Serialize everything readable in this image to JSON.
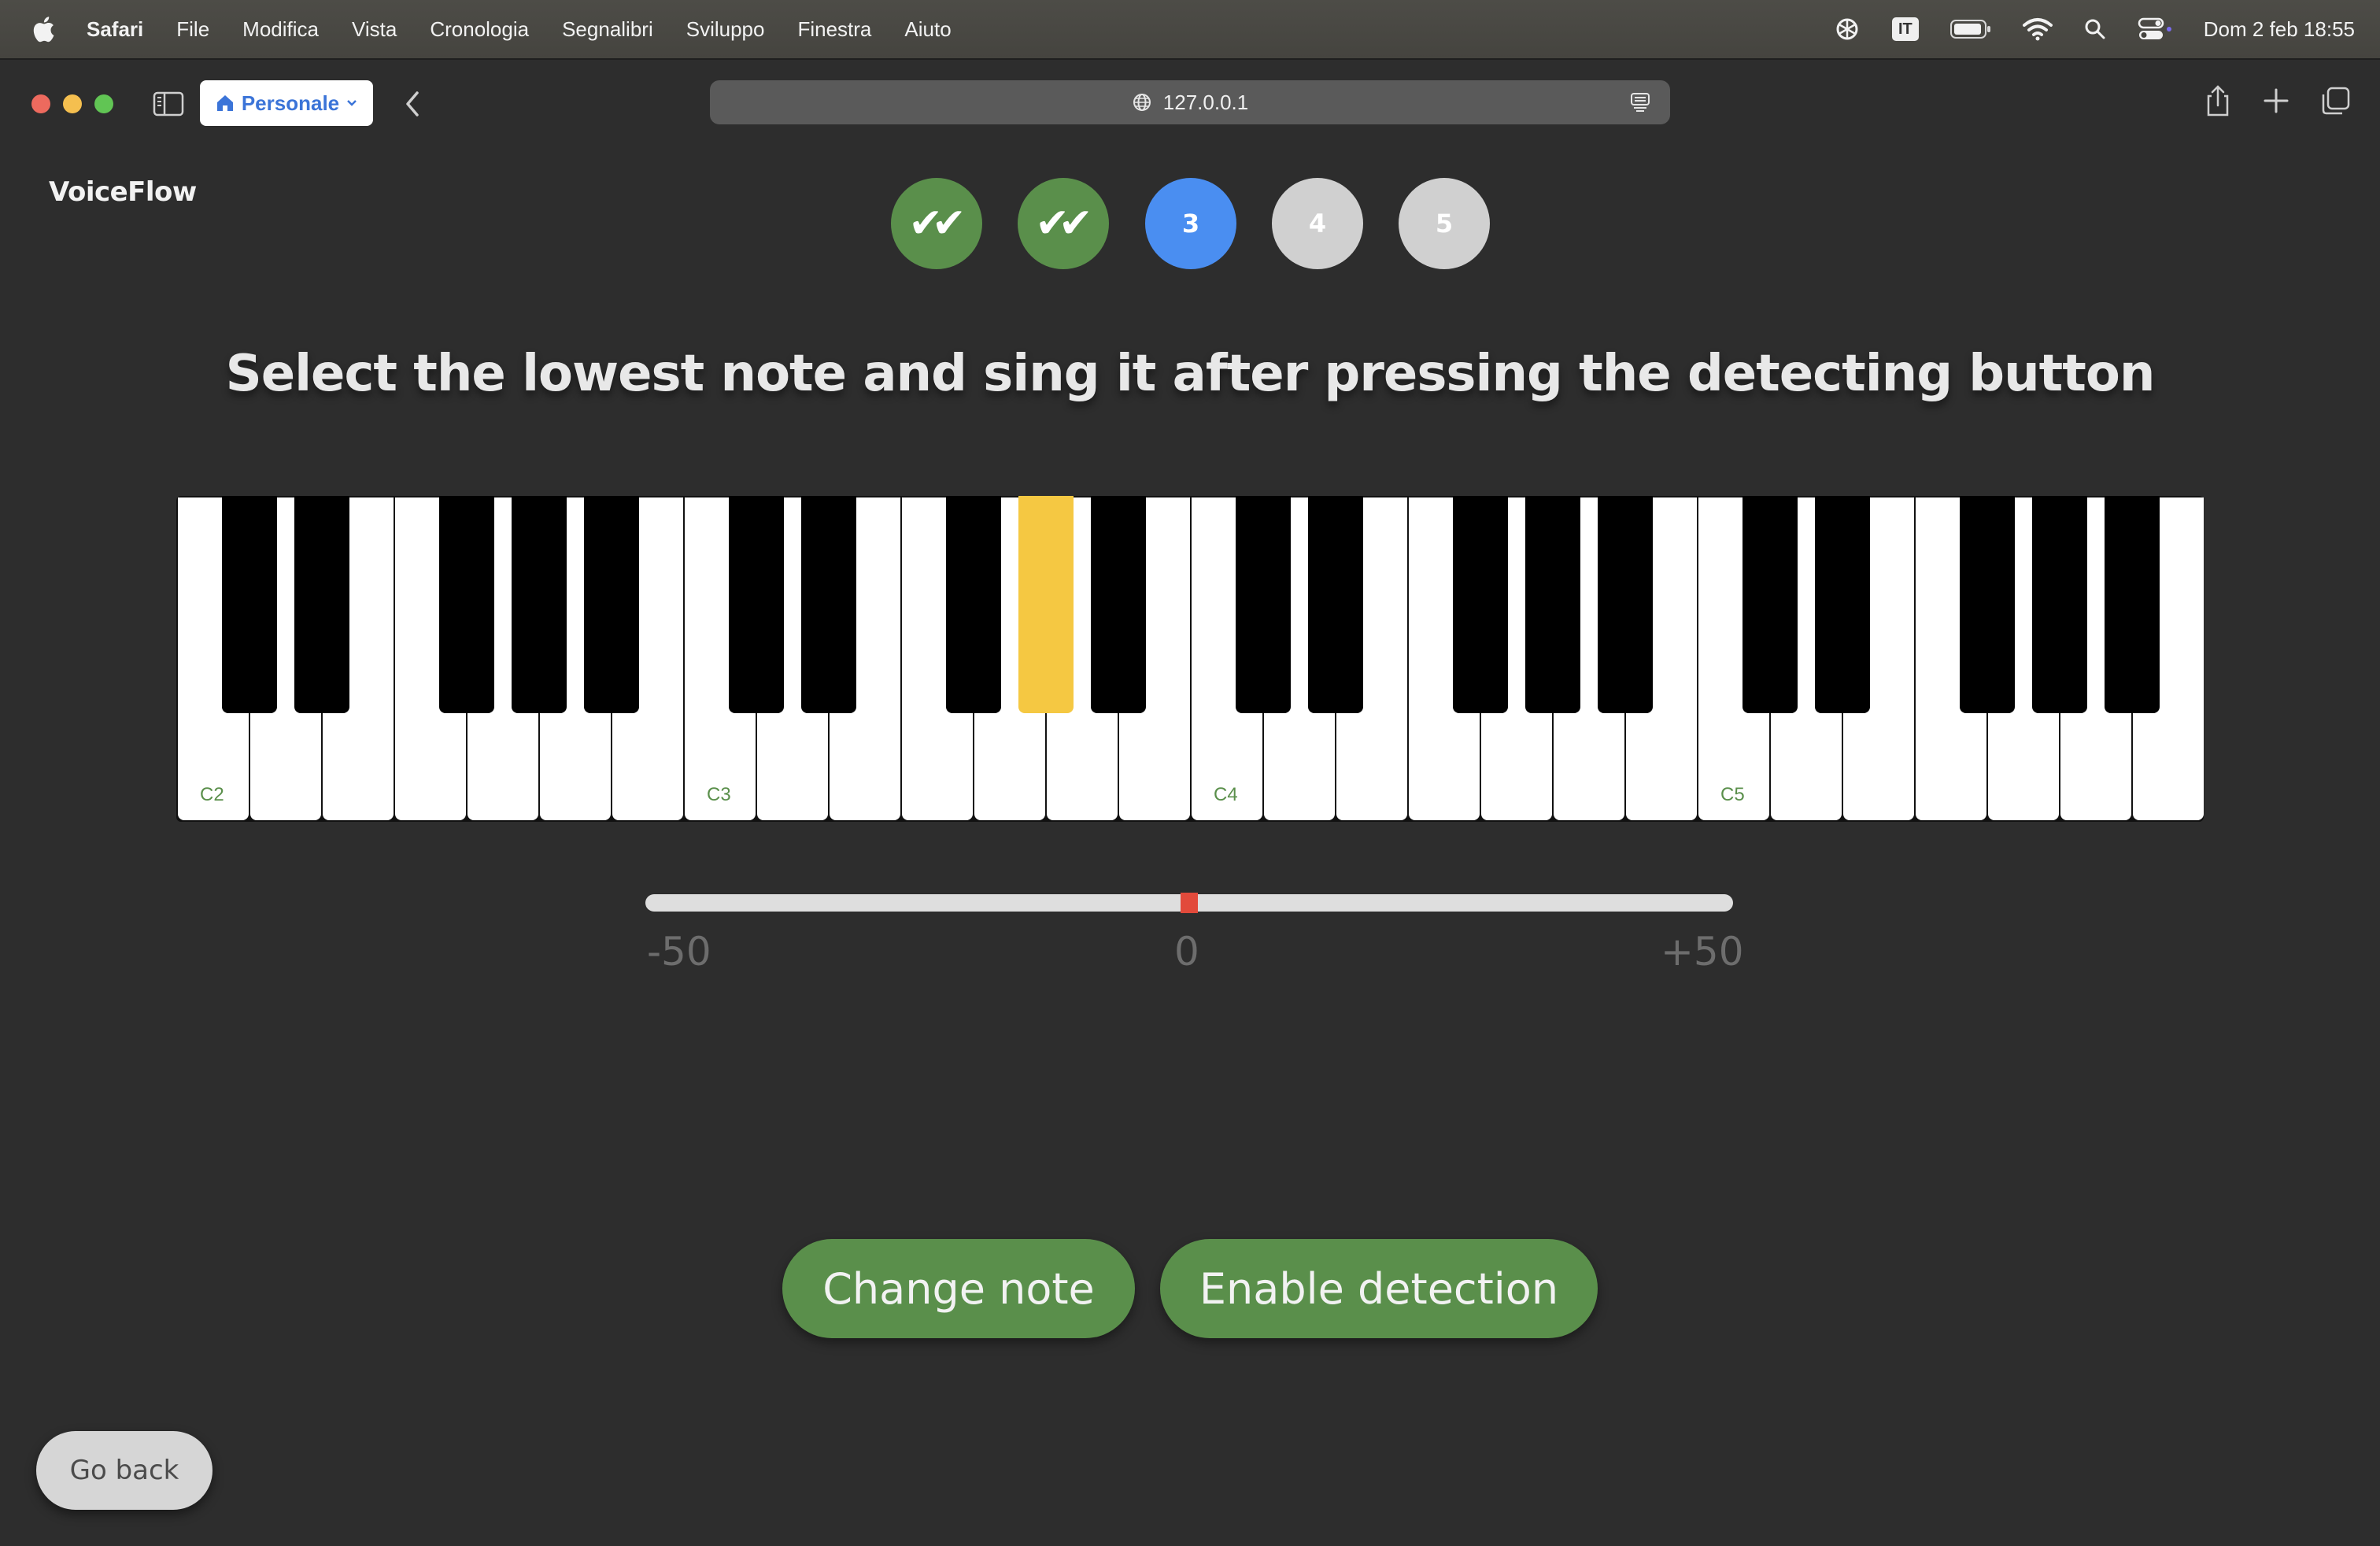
{
  "menubar": {
    "app_name": "Safari",
    "items": [
      "File",
      "Modifica",
      "Vista",
      "Cronologia",
      "Segnalibri",
      "Sviluppo",
      "Finestra",
      "Aiuto"
    ],
    "input_source": "IT",
    "clock": "Dom 2 feb  18:55"
  },
  "browser": {
    "profile_label": "Personale",
    "address": "127.0.0.1"
  },
  "app": {
    "brand": "VoiceFlow",
    "steps": [
      {
        "label": "✔✔",
        "state": "done"
      },
      {
        "label": "✔✔",
        "state": "done"
      },
      {
        "label": "3",
        "state": "current"
      },
      {
        "label": "4",
        "state": "todo"
      },
      {
        "label": "5",
        "state": "todo"
      }
    ],
    "instruction": "Select the lowest note and sing it after pressing the detecting button",
    "piano": {
      "octave_labels": [
        "C2",
        "C3",
        "C4",
        "C5"
      ],
      "selected_key": "G#3"
    },
    "meter": {
      "min_label": "-50",
      "mid_label": "0",
      "max_label": "+50",
      "value": 0
    },
    "buttons": {
      "change_note": "Change note",
      "enable_detection": "Enable detection",
      "go_back": "Go back"
    }
  },
  "colors": {
    "background": "#2d2d2d",
    "primary_green": "#5a8f4b",
    "current_step_blue": "#4a8ef1",
    "selected_key_yellow": "#f5c842",
    "meter_marker_red": "#e24a3b"
  }
}
